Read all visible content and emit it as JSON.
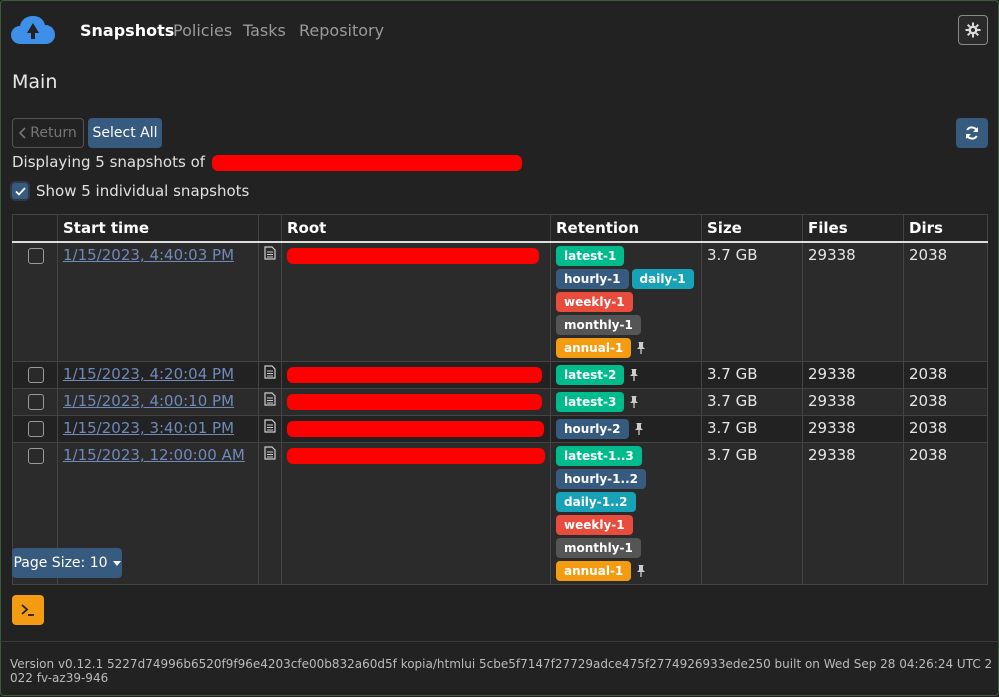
{
  "nav": {
    "items": [
      {
        "label": "Snapshots",
        "active": true
      },
      {
        "label": "Policies",
        "active": false
      },
      {
        "label": "Tasks",
        "active": false
      },
      {
        "label": "Repository",
        "active": false
      }
    ]
  },
  "page": {
    "title": "Main"
  },
  "toolbar": {
    "return_label": "Return",
    "select_all_label": "Select All"
  },
  "summary": {
    "displaying_text": "Displaying 5 snapshots of",
    "show_individual_label": "Show 5 individual snapshots",
    "show_individual_checked": true
  },
  "table": {
    "headers": [
      "",
      "Start time",
      "",
      "Root",
      "Retention",
      "Size",
      "Files",
      "Dirs"
    ],
    "rows": [
      {
        "time": "1/15/2023, 4:40:03 PM",
        "size": "3.7 GB",
        "files": "29338",
        "dirs": "2038",
        "badges": [
          {
            "text": "latest-1",
            "kind": "latest"
          },
          {
            "text": "hourly-1",
            "kind": "hourly"
          },
          {
            "text": "daily-1",
            "kind": "daily"
          },
          {
            "text": "weekly-1",
            "kind": "weekly"
          },
          {
            "text": "monthly-1",
            "kind": "monthly"
          },
          {
            "text": "annual-1",
            "kind": "annual"
          }
        ]
      },
      {
        "time": "1/15/2023, 4:20:04 PM",
        "size": "3.7 GB",
        "files": "29338",
        "dirs": "2038",
        "badges": [
          {
            "text": "latest-2",
            "kind": "latest"
          }
        ]
      },
      {
        "time": "1/15/2023, 4:00:10 PM",
        "size": "3.7 GB",
        "files": "29338",
        "dirs": "2038",
        "badges": [
          {
            "text": "latest-3",
            "kind": "latest"
          }
        ]
      },
      {
        "time": "1/15/2023, 3:40:01 PM",
        "size": "3.7 GB",
        "files": "29338",
        "dirs": "2038",
        "badges": [
          {
            "text": "hourly-2",
            "kind": "hourly"
          }
        ]
      },
      {
        "time": "1/15/2023, 12:00:00 AM",
        "size": "3.7 GB",
        "files": "29338",
        "dirs": "2038",
        "badges": [
          {
            "text": "latest-1..3",
            "kind": "latest"
          },
          {
            "text": "hourly-1..2",
            "kind": "hourly"
          },
          {
            "text": "daily-1..2",
            "kind": "daily"
          },
          {
            "text": "weekly-1",
            "kind": "weekly"
          },
          {
            "text": "monthly-1",
            "kind": "monthly"
          },
          {
            "text": "annual-1",
            "kind": "annual"
          }
        ]
      }
    ]
  },
  "pagination": {
    "page_size_label": "Page Size: 10"
  },
  "footer": {
    "version_text": "Version v0.12.1 5227d74996b6520f9f96e4203cfe00b832a60d5f kopia/htmlui 5cbe5f7147f27729adce475f2774926933ede250 built on Wed Sep 28 04:26:24 UTC 2022 fv-az39-946"
  },
  "colors": {
    "accent": "#375a7f",
    "latest": "#00bc8c",
    "daily": "#17a2b8",
    "weekly": "#e74c3c",
    "monthly": "#555555",
    "annual": "#f39c12",
    "link": "#7189b8"
  },
  "icons": {
    "logo": "cloud-logo-icon",
    "gear": "gear-icon",
    "refresh": "refresh-icon",
    "file": "file-icon",
    "pin": "pin-icon",
    "terminal": "terminal-icon",
    "chevron_left": "chevron-left-icon",
    "caret_down": "caret-down-icon"
  }
}
